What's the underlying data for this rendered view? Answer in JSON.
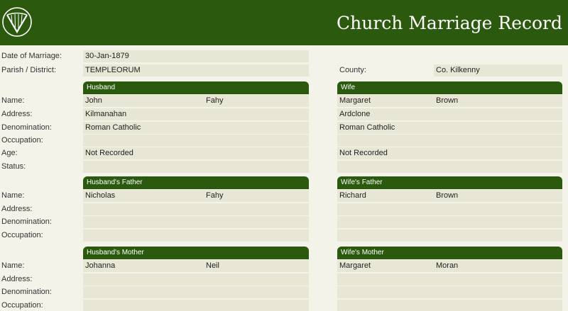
{
  "app": {
    "title": "Church Marriage Record"
  },
  "record": {
    "date_label": "Date of Marriage:",
    "date_value": "30-Jan-1879",
    "parish_label": "Parish / District:",
    "parish_value": "TEMPLEORUM",
    "county_label": "County:",
    "county_value": "Co. Kilkenny"
  },
  "labels": {
    "name": "Name:",
    "address": "Address:",
    "denomination": "Denomination:",
    "occupation": "Occupation:",
    "age": "Age:",
    "status": "Status:"
  },
  "husband": {
    "header": "Husband",
    "first_name": "John",
    "surname": "Fahy",
    "address": "Kilmanahan",
    "denomination": "Roman Catholic",
    "occupation": "",
    "age": "Not Recorded",
    "status": ""
  },
  "wife": {
    "header": "Wife",
    "first_name": "Margaret",
    "surname": "Brown",
    "address": "Ardclone",
    "denomination": "Roman Catholic",
    "occupation": "",
    "age": "Not Recorded",
    "status": ""
  },
  "husband_father": {
    "header": "Husband's Father",
    "first_name": "Nicholas",
    "surname": "Fahy",
    "address": "",
    "denomination": "",
    "occupation": ""
  },
  "wife_father": {
    "header": "Wife's Father",
    "first_name": "Richard",
    "surname": "Brown",
    "address": "",
    "denomination": "",
    "occupation": ""
  },
  "husband_mother": {
    "header": "Husband's Mother",
    "first_name": "Johanna",
    "surname": "Neil",
    "address": "",
    "denomination": "",
    "occupation": ""
  },
  "wife_mother": {
    "header": "Wife's Mother",
    "first_name": "Margaret",
    "surname": "Moran",
    "address": "",
    "denomination": "",
    "occupation": ""
  },
  "icons": {
    "logo": "harp-logo-icon"
  },
  "colors": {
    "brand_green": "#2b5a0f",
    "field_bg": "#e8e7d5",
    "page_bg": "#f4f3ea"
  }
}
